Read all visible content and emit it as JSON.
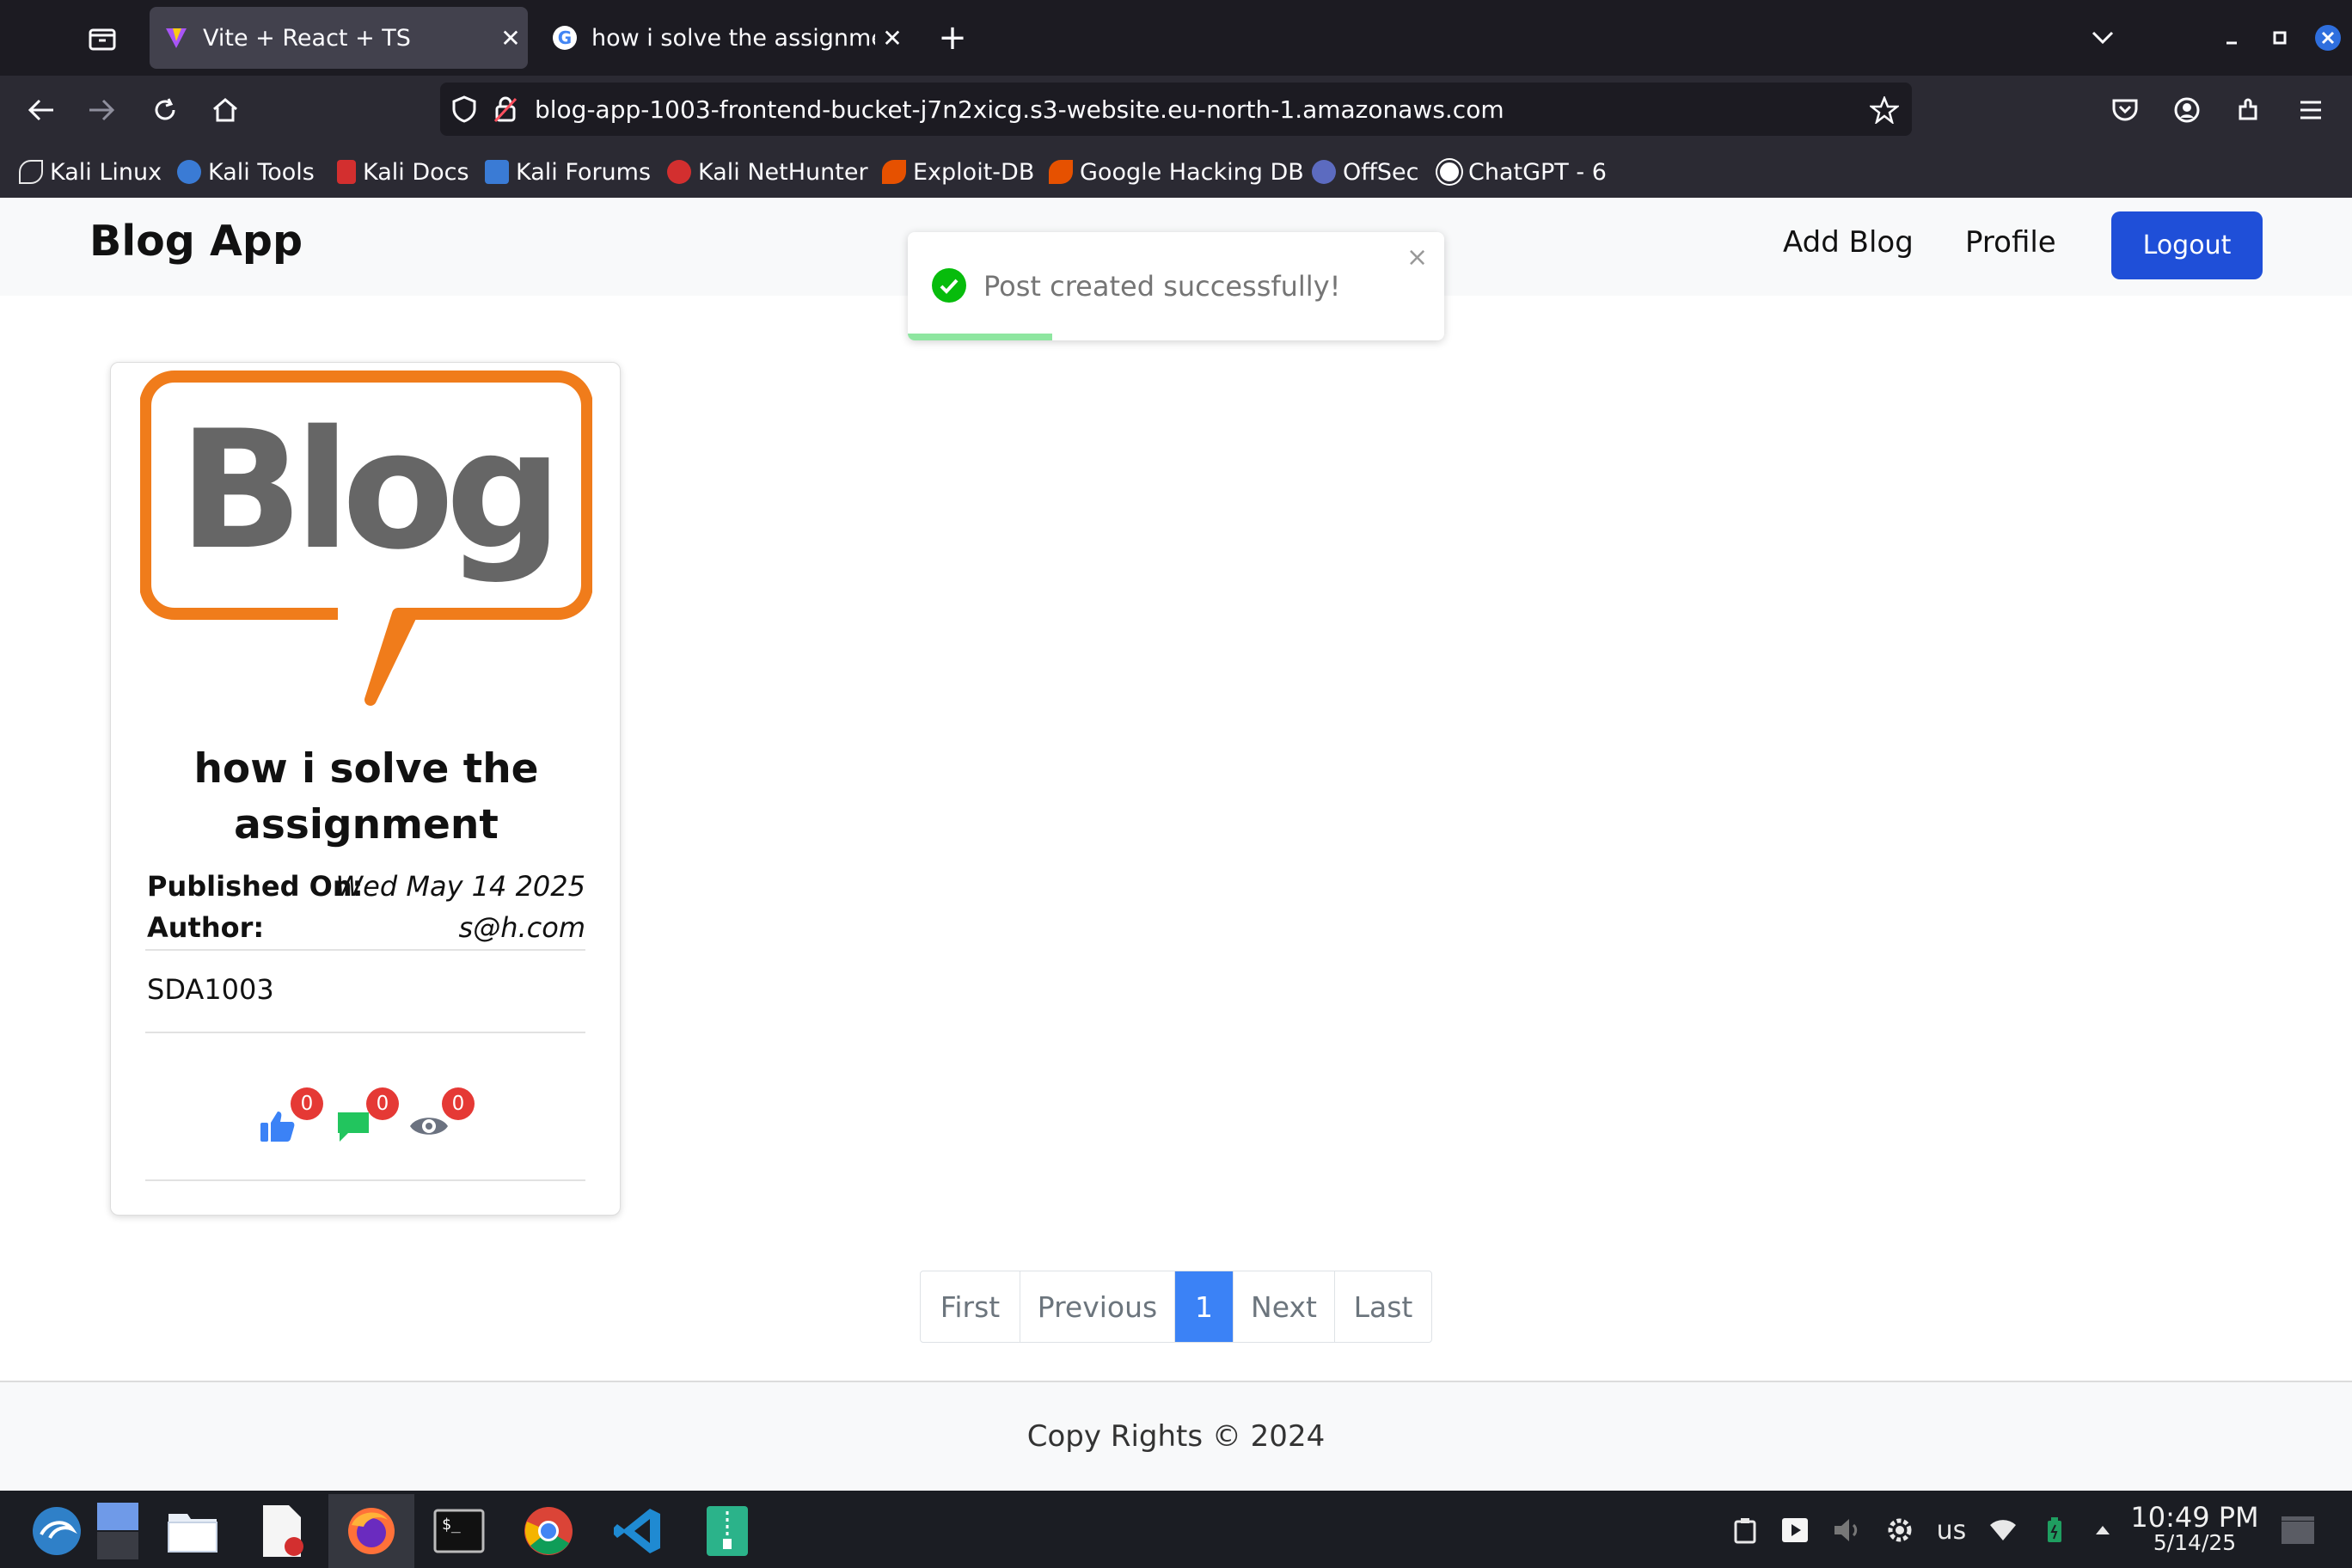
{
  "browser": {
    "tabs": [
      {
        "title": "Vite + React + TS",
        "active": true
      },
      {
        "title": "how i solve the assignment",
        "active": false
      }
    ],
    "url": "blog-app-1003-frontend-bucket-j7n2xicg.s3-website.eu-north-1.amazonaws.com",
    "bookmarks": [
      {
        "label": "Kali Linux",
        "color": "#e8e8e8"
      },
      {
        "label": "Kali Tools",
        "color": "#3a7bd5"
      },
      {
        "label": "Kali Docs",
        "color": "#d32f2f"
      },
      {
        "label": "Kali Forums",
        "color": "#3a7bd5"
      },
      {
        "label": "Kali NetHunter",
        "color": "#d32f2f"
      },
      {
        "label": "Exploit-DB",
        "color": "#e65100"
      },
      {
        "label": "Google Hacking DB",
        "color": "#e65100"
      },
      {
        "label": "OffSec",
        "color": "#5c6bc0"
      },
      {
        "label": "ChatGPT - 6",
        "color": "#ffffff"
      }
    ]
  },
  "app": {
    "brand": "Blog App",
    "nav": {
      "add_blog": "Add Blog",
      "profile": "Profile",
      "logout": "Logout"
    },
    "toast": {
      "message": "Post created successfully!",
      "close": "×",
      "progress": 0.27
    },
    "post": {
      "image_text": "Blog",
      "title_line1": "how i solve the",
      "title_line2": "assignment",
      "published_label": "Published On:",
      "published_value": "Wed May 14 2025",
      "author_label": "Author:",
      "author_value": "s@h.com",
      "body": "SDA1003",
      "likes": "0",
      "comments": "0",
      "views": "0"
    },
    "pagination": [
      "First",
      "Previous",
      "1",
      "Next",
      "Last"
    ],
    "pagination_active": "1",
    "footer": "Copy Rights © 2024"
  },
  "taskbar": {
    "keyboard_layout": "us",
    "time": "10:49 PM",
    "date": "5/14/25"
  },
  "colors": {
    "primary": "#1f4fd8",
    "page_active": "#3b82f6",
    "badge": "#e53935",
    "toast_success": "#07bc0c",
    "blog_logo_orange": "#f07c1b",
    "blog_logo_gray": "#666666"
  }
}
